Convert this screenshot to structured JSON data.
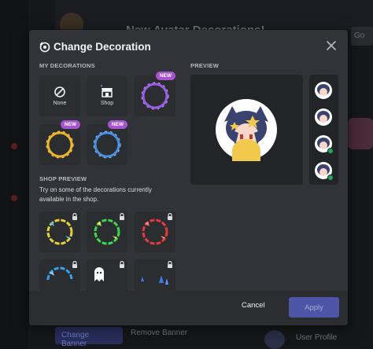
{
  "background": {
    "header_title": "New Avatar Decorations!",
    "right_button": "Go",
    "change_banner": "Change Banner",
    "remove_banner": "Remove Banner",
    "user_profile": "User Profile"
  },
  "modal": {
    "title": "Change Decoration",
    "close_icon": "close-icon",
    "my_decorations_label": "MY DECORATIONS",
    "preview_label": "PREVIEW",
    "my_decorations": [
      {
        "name": "none",
        "label": "None",
        "icon": "none-icon",
        "new": false
      },
      {
        "name": "shop",
        "label": "Shop",
        "icon": "shop-icon",
        "new": false
      },
      {
        "name": "purple-ring",
        "label": "",
        "icon": "purple-ring",
        "new": true,
        "color": "#9b5de5"
      },
      {
        "name": "gold-ring",
        "label": "",
        "icon": "gold-ring",
        "new": true,
        "color": "#f0b429"
      },
      {
        "name": "blue-ring",
        "label": "",
        "icon": "blue-ring",
        "new": true,
        "color": "#4a90e2"
      }
    ],
    "new_badge": "NEW",
    "shop_preview_label": "SHOP PREVIEW",
    "shop_description": "Try on some of the decorations currently available in the shop.",
    "shop_items": [
      {
        "name": "yellow-lightning",
        "color": "#e8d23a"
      },
      {
        "name": "green-lightning",
        "color": "#3adb4a"
      },
      {
        "name": "red-lightning",
        "color": "#e53b3b"
      },
      {
        "name": "blue-lightning",
        "color": "#3aa0e8"
      },
      {
        "name": "ghost",
        "color": "#ffffff"
      },
      {
        "name": "blue-drops",
        "color": "#3a7be8"
      }
    ],
    "footer": {
      "cancel": "Cancel",
      "apply": "Apply"
    }
  },
  "colors": {
    "modal_bg": "#313338",
    "tile_bg": "#2b2d31",
    "new_badge": "#a854d1",
    "apply_button": "#4d56a6",
    "status_online": "#23a55a"
  }
}
